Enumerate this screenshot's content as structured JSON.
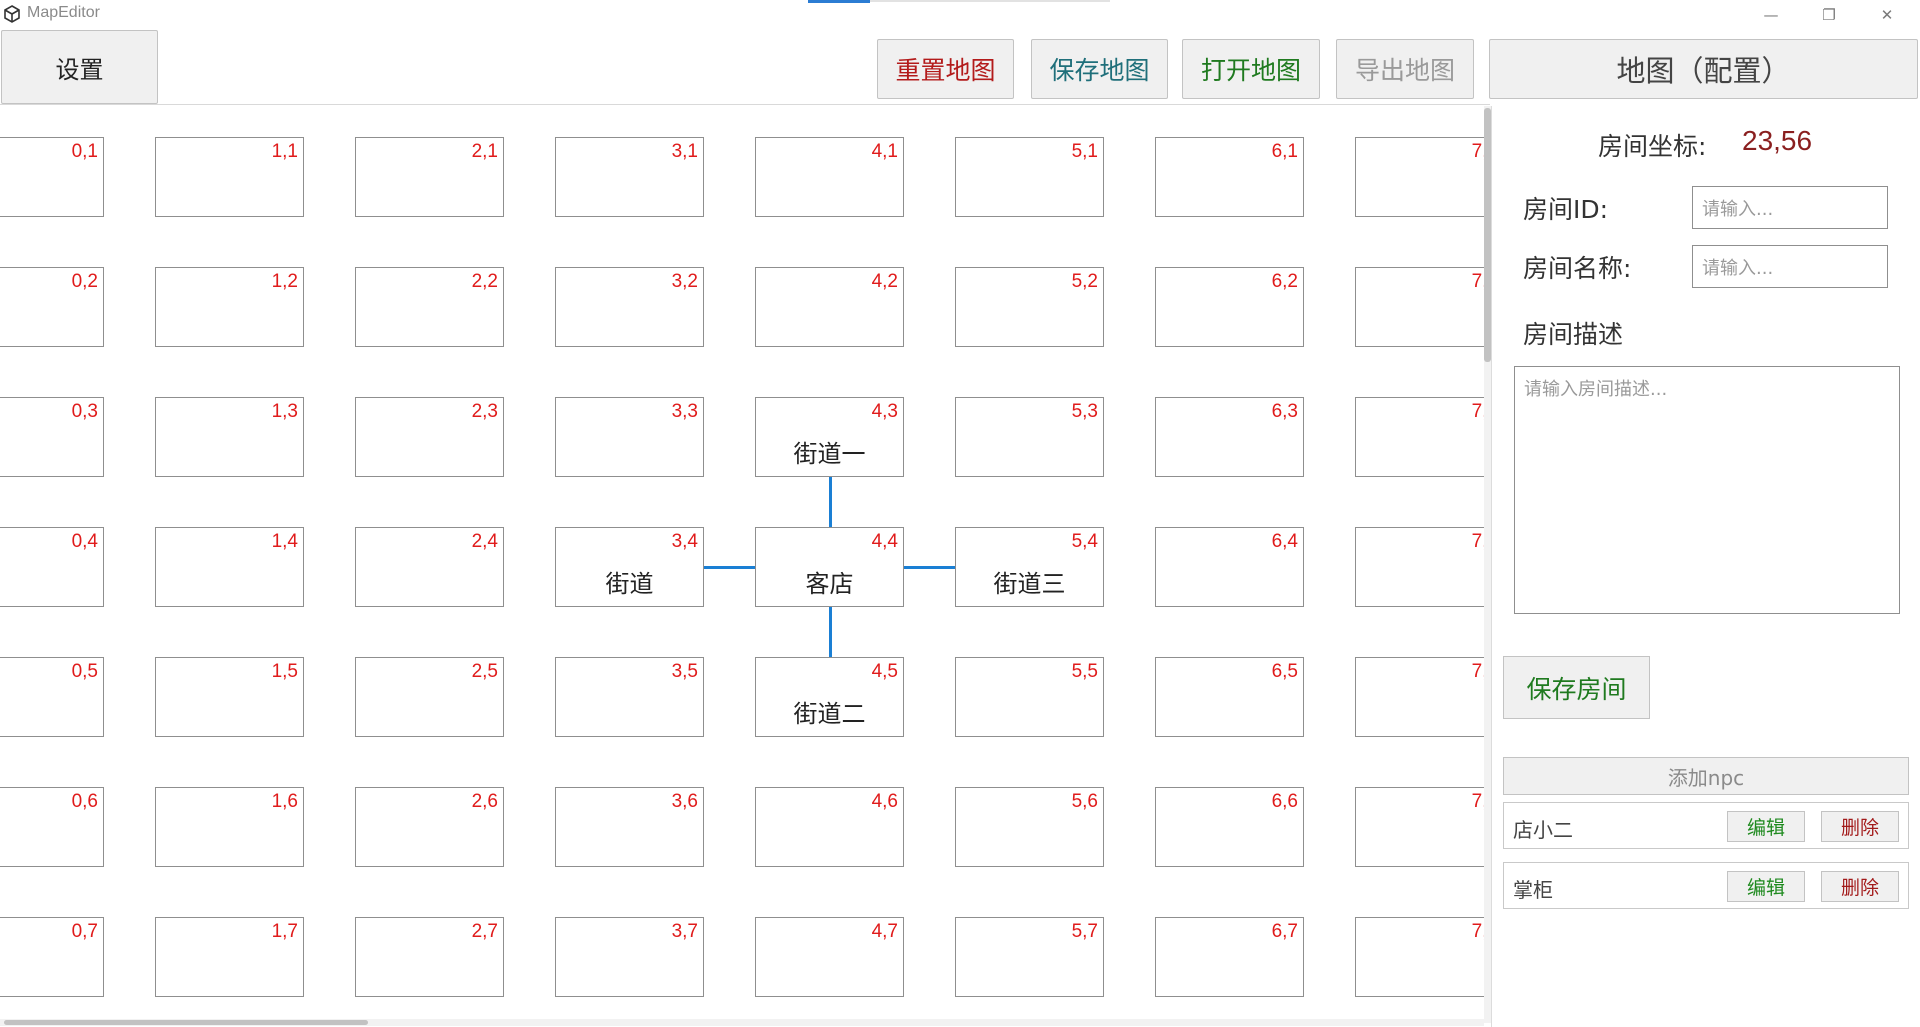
{
  "window": {
    "title": "MapEditor",
    "minimize_glyph": "—",
    "maximize_glyph": "❐",
    "close_glyph": "✕",
    "icon": "unity-logo-icon"
  },
  "toolbar": {
    "settings_label": "设置",
    "reset_map_label": "重置地图",
    "save_map_label": "保存地图",
    "open_map_label": "打开地图",
    "export_map_label": "导出地图",
    "map_config_label": "地图（配置）"
  },
  "map": {
    "columns": [
      0,
      1,
      2,
      3,
      4,
      5,
      6,
      7
    ],
    "rows": [
      1,
      2,
      3,
      4,
      5,
      6,
      7
    ],
    "named_rooms": {
      "4,3": "街道一",
      "3,4": "街道",
      "4,4": "客店",
      "5,4": "街道三",
      "4,5": "街道二"
    },
    "link_color": "#1a7fd4",
    "coord_color": "#e01b1b"
  },
  "room_panel": {
    "coord_label": "房间坐标:",
    "coord_value": "23,56",
    "id_label": "房间ID:",
    "id_placeholder": "请输入...",
    "name_label": "房间名称:",
    "name_placeholder": "请输入...",
    "desc_label": "房间描述",
    "desc_placeholder": "请输入房间描述...",
    "save_room_label": "保存房间"
  },
  "npc_panel": {
    "add_label": "添加npc",
    "items": [
      {
        "name": "店小二",
        "edit_label": "编辑",
        "delete_label": "删除"
      },
      {
        "name": "掌柜",
        "edit_label": "编辑",
        "delete_label": "删除"
      }
    ]
  }
}
